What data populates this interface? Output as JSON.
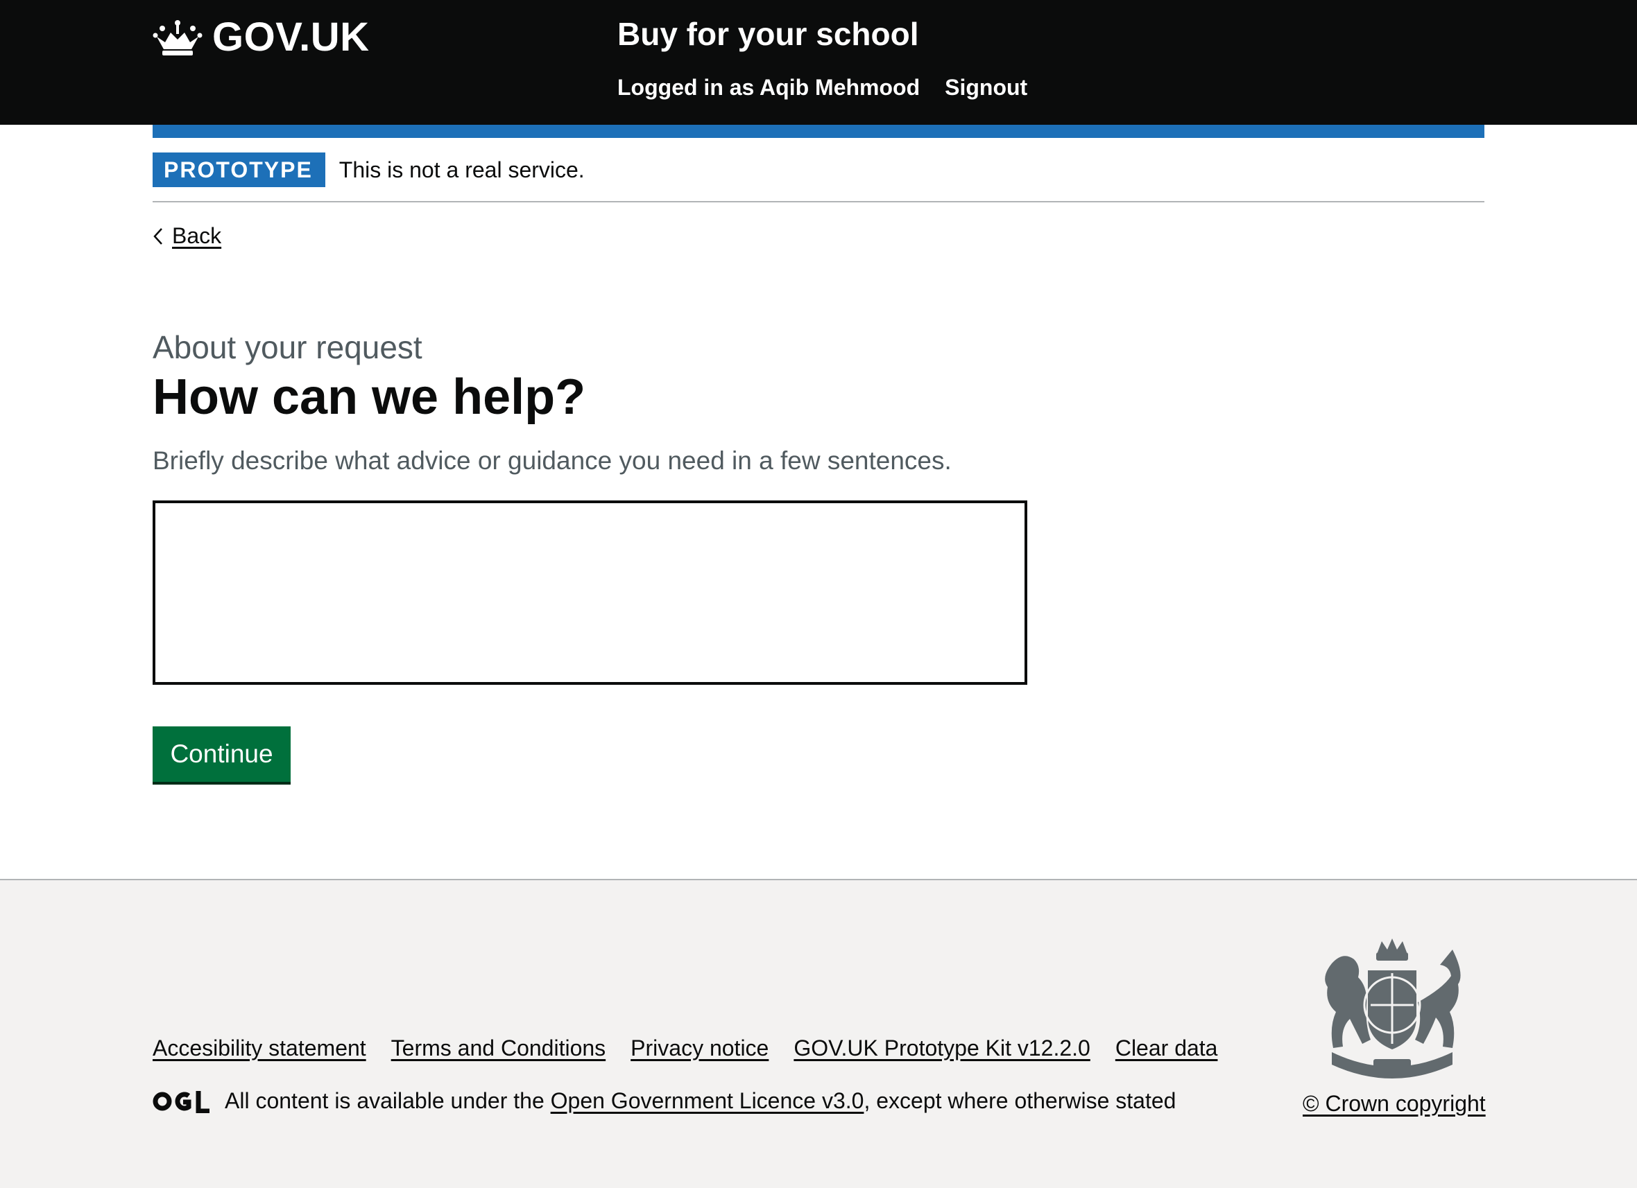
{
  "header": {
    "logo_text": "GOV.UK",
    "service_name": "Buy for your school",
    "nav": {
      "user_label": "Logged in as Aqib Mehmood",
      "signout_label": "Signout"
    }
  },
  "phase_banner": {
    "tag": "PROTOTYPE",
    "text": "This is not a real service."
  },
  "back_link": {
    "label": "Back"
  },
  "main": {
    "caption": "About your request",
    "heading": "How can we help?",
    "hint": "Briefly describe what advice or guidance you need in a few sentences.",
    "textarea_value": "",
    "continue_label": "Continue"
  },
  "footer": {
    "links": [
      "Accesibility statement",
      "Terms and Conditions",
      "Privacy notice",
      "GOV.UK Prototype Kit v12.2.0",
      "Clear data"
    ],
    "licence_prefix": "All content is available under the ",
    "licence_link": "Open Government Licence v3.0",
    "licence_suffix": ", except where otherwise stated",
    "copyright": "© Crown copyright"
  },
  "colors": {
    "header_bg": "#0b0c0c",
    "brand_blue": "#1d70b8",
    "button_green": "#00703c",
    "footer_bg": "#f3f2f1",
    "secondary_text": "#505a5f"
  },
  "icons": {
    "logo": "crown-icon",
    "back": "chevron-left-icon",
    "licence": "ogl-logo-icon",
    "crest": "royal-coat-of-arms-icon"
  }
}
